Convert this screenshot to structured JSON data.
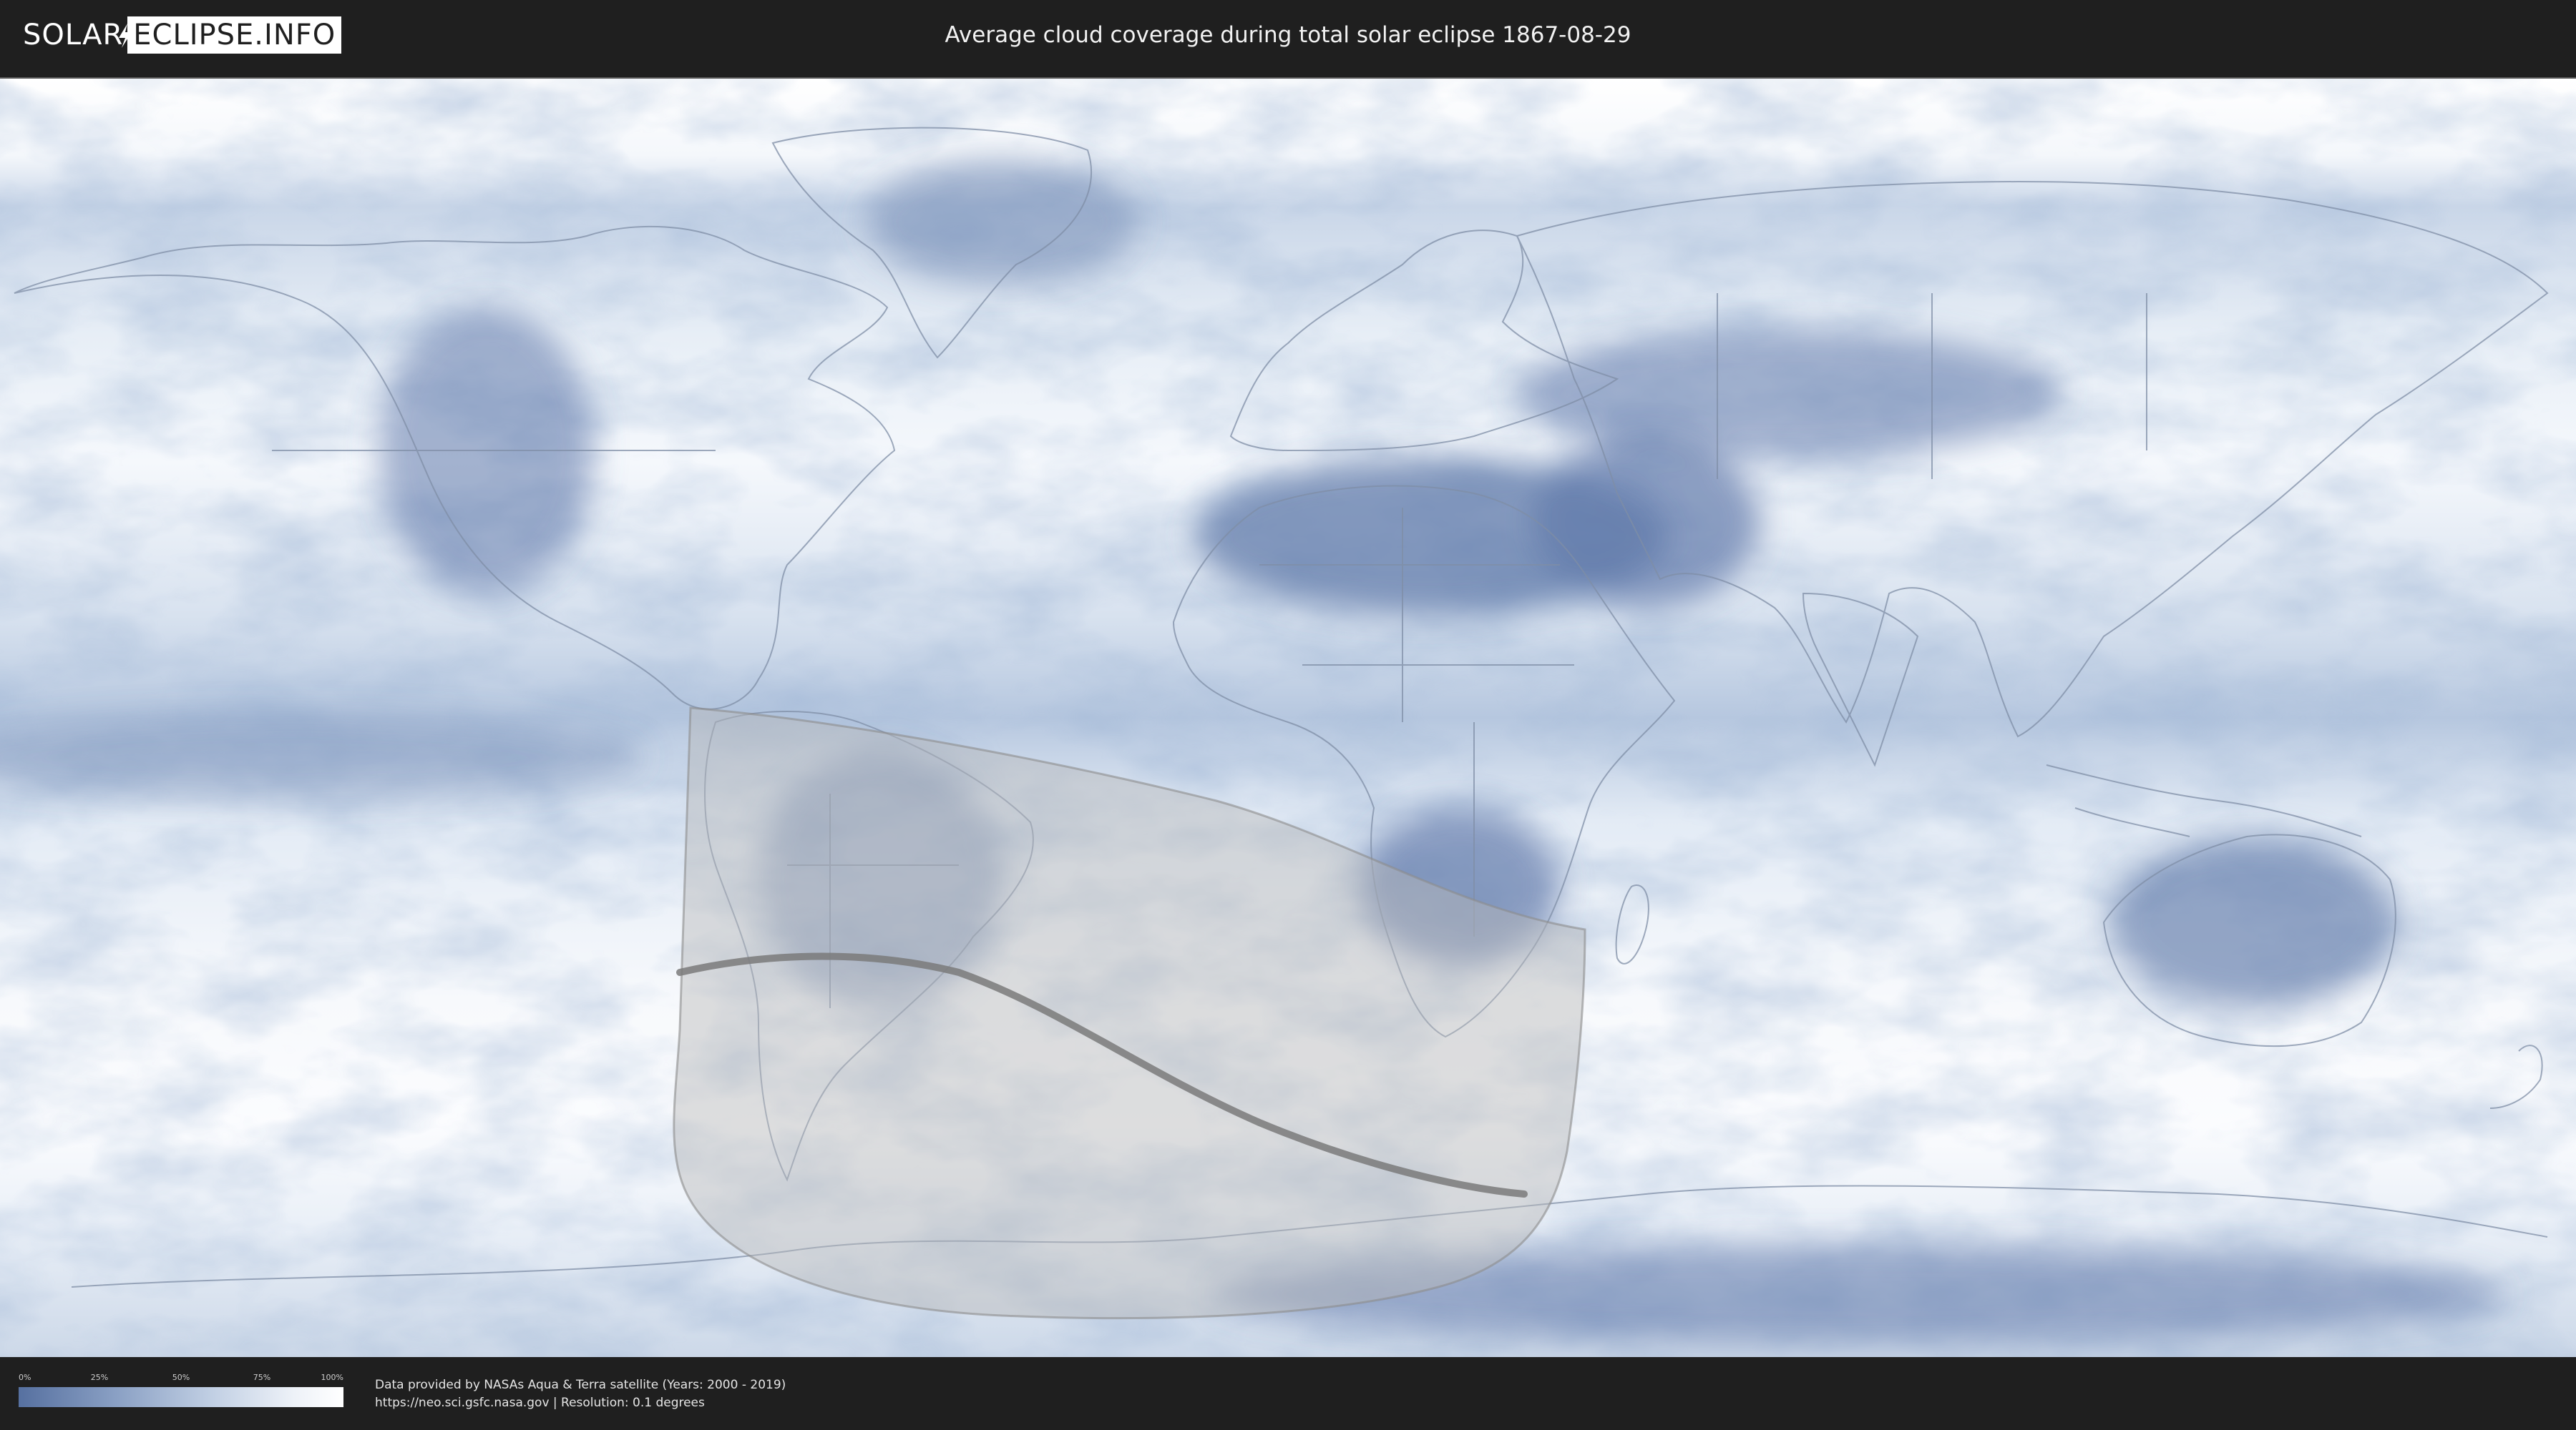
{
  "header": {
    "logo": {
      "left_text": "SOLAR",
      "right_text": "ECLIPSE.INFO"
    },
    "title": "Average cloud coverage during total solar eclipse 1867-08-29"
  },
  "map": {
    "projection": "equirectangular",
    "layers": [
      "cloud-coverage-raster",
      "country-borders",
      "eclipse-visibility-zone",
      "totality-path"
    ],
    "colors": {
      "cloud_low": "#5670a0",
      "cloud_high": "#ffffff",
      "eclipse_zone": "#bdbdbd",
      "totality_path": "#7a7a7a"
    }
  },
  "legend": {
    "ticks": [
      "0%",
      "25%",
      "50%",
      "75%",
      "100%"
    ],
    "gradient": [
      "#5670a0",
      "#8aa0c4",
      "#c2d0e4",
      "#eef2f8",
      "#ffffff"
    ]
  },
  "footer": {
    "credit_line_1": "Data provided by NASAs Aqua & Terra satellite (Years: 2000 - 2019)",
    "credit_line_2": "https://neo.sci.gsfc.nasa.gov | Resolution: 0.1 degrees"
  }
}
